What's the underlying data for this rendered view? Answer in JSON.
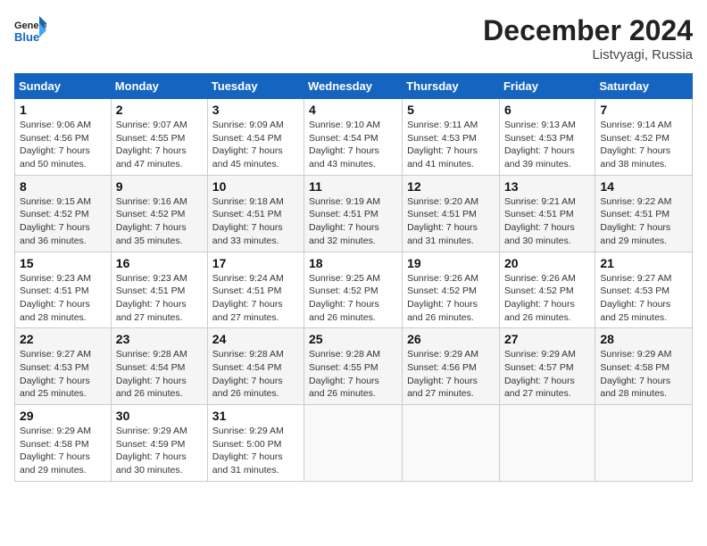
{
  "header": {
    "logo_general": "General",
    "logo_blue": "Blue",
    "month_title": "December 2024",
    "location": "Listvyagi, Russia"
  },
  "weekdays": [
    "Sunday",
    "Monday",
    "Tuesday",
    "Wednesday",
    "Thursday",
    "Friday",
    "Saturday"
  ],
  "weeks": [
    [
      {
        "day": "1",
        "info": "Sunrise: 9:06 AM\nSunset: 4:56 PM\nDaylight: 7 hours\nand 50 minutes."
      },
      {
        "day": "2",
        "info": "Sunrise: 9:07 AM\nSunset: 4:55 PM\nDaylight: 7 hours\nand 47 minutes."
      },
      {
        "day": "3",
        "info": "Sunrise: 9:09 AM\nSunset: 4:54 PM\nDaylight: 7 hours\nand 45 minutes."
      },
      {
        "day": "4",
        "info": "Sunrise: 9:10 AM\nSunset: 4:54 PM\nDaylight: 7 hours\nand 43 minutes."
      },
      {
        "day": "5",
        "info": "Sunrise: 9:11 AM\nSunset: 4:53 PM\nDaylight: 7 hours\nand 41 minutes."
      },
      {
        "day": "6",
        "info": "Sunrise: 9:13 AM\nSunset: 4:53 PM\nDaylight: 7 hours\nand 39 minutes."
      },
      {
        "day": "7",
        "info": "Sunrise: 9:14 AM\nSunset: 4:52 PM\nDaylight: 7 hours\nand 38 minutes."
      }
    ],
    [
      {
        "day": "8",
        "info": "Sunrise: 9:15 AM\nSunset: 4:52 PM\nDaylight: 7 hours\nand 36 minutes."
      },
      {
        "day": "9",
        "info": "Sunrise: 9:16 AM\nSunset: 4:52 PM\nDaylight: 7 hours\nand 35 minutes."
      },
      {
        "day": "10",
        "info": "Sunrise: 9:18 AM\nSunset: 4:51 PM\nDaylight: 7 hours\nand 33 minutes."
      },
      {
        "day": "11",
        "info": "Sunrise: 9:19 AM\nSunset: 4:51 PM\nDaylight: 7 hours\nand 32 minutes."
      },
      {
        "day": "12",
        "info": "Sunrise: 9:20 AM\nSunset: 4:51 PM\nDaylight: 7 hours\nand 31 minutes."
      },
      {
        "day": "13",
        "info": "Sunrise: 9:21 AM\nSunset: 4:51 PM\nDaylight: 7 hours\nand 30 minutes."
      },
      {
        "day": "14",
        "info": "Sunrise: 9:22 AM\nSunset: 4:51 PM\nDaylight: 7 hours\nand 29 minutes."
      }
    ],
    [
      {
        "day": "15",
        "info": "Sunrise: 9:23 AM\nSunset: 4:51 PM\nDaylight: 7 hours\nand 28 minutes."
      },
      {
        "day": "16",
        "info": "Sunrise: 9:23 AM\nSunset: 4:51 PM\nDaylight: 7 hours\nand 27 minutes."
      },
      {
        "day": "17",
        "info": "Sunrise: 9:24 AM\nSunset: 4:51 PM\nDaylight: 7 hours\nand 27 minutes."
      },
      {
        "day": "18",
        "info": "Sunrise: 9:25 AM\nSunset: 4:52 PM\nDaylight: 7 hours\nand 26 minutes."
      },
      {
        "day": "19",
        "info": "Sunrise: 9:26 AM\nSunset: 4:52 PM\nDaylight: 7 hours\nand 26 minutes."
      },
      {
        "day": "20",
        "info": "Sunrise: 9:26 AM\nSunset: 4:52 PM\nDaylight: 7 hours\nand 26 minutes."
      },
      {
        "day": "21",
        "info": "Sunrise: 9:27 AM\nSunset: 4:53 PM\nDaylight: 7 hours\nand 25 minutes."
      }
    ],
    [
      {
        "day": "22",
        "info": "Sunrise: 9:27 AM\nSunset: 4:53 PM\nDaylight: 7 hours\nand 25 minutes."
      },
      {
        "day": "23",
        "info": "Sunrise: 9:28 AM\nSunset: 4:54 PM\nDaylight: 7 hours\nand 26 minutes."
      },
      {
        "day": "24",
        "info": "Sunrise: 9:28 AM\nSunset: 4:54 PM\nDaylight: 7 hours\nand 26 minutes."
      },
      {
        "day": "25",
        "info": "Sunrise: 9:28 AM\nSunset: 4:55 PM\nDaylight: 7 hours\nand 26 minutes."
      },
      {
        "day": "26",
        "info": "Sunrise: 9:29 AM\nSunset: 4:56 PM\nDaylight: 7 hours\nand 27 minutes."
      },
      {
        "day": "27",
        "info": "Sunrise: 9:29 AM\nSunset: 4:57 PM\nDaylight: 7 hours\nand 27 minutes."
      },
      {
        "day": "28",
        "info": "Sunrise: 9:29 AM\nSunset: 4:58 PM\nDaylight: 7 hours\nand 28 minutes."
      }
    ],
    [
      {
        "day": "29",
        "info": "Sunrise: 9:29 AM\nSunset: 4:58 PM\nDaylight: 7 hours\nand 29 minutes."
      },
      {
        "day": "30",
        "info": "Sunrise: 9:29 AM\nSunset: 4:59 PM\nDaylight: 7 hours\nand 30 minutes."
      },
      {
        "day": "31",
        "info": "Sunrise: 9:29 AM\nSunset: 5:00 PM\nDaylight: 7 hours\nand 31 minutes."
      },
      {
        "day": "",
        "info": ""
      },
      {
        "day": "",
        "info": ""
      },
      {
        "day": "",
        "info": ""
      },
      {
        "day": "",
        "info": ""
      }
    ]
  ]
}
